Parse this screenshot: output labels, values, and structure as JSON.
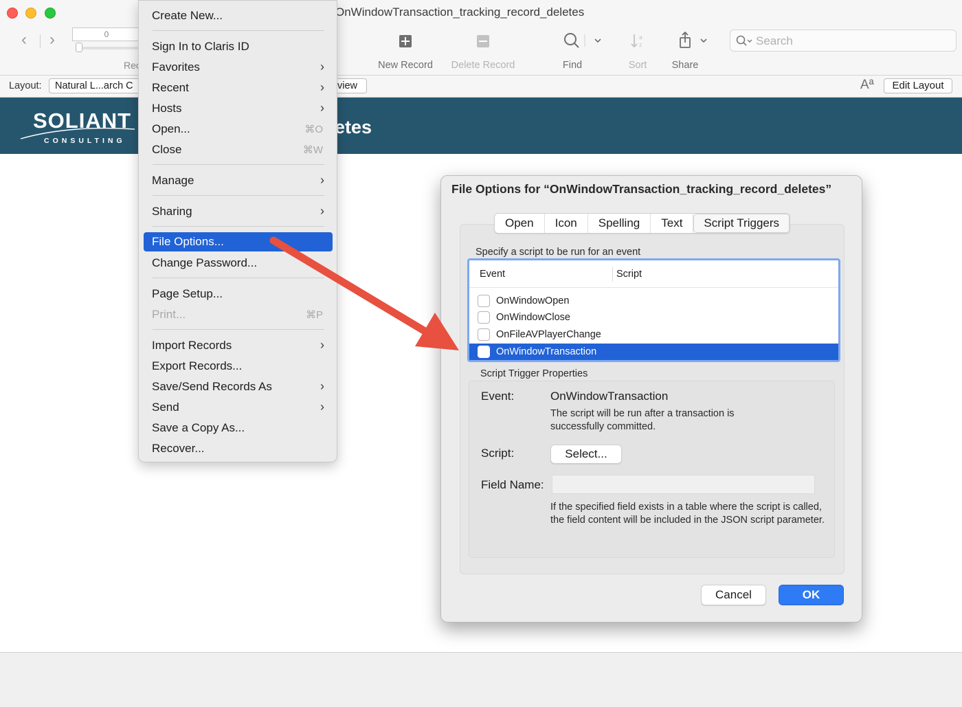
{
  "window": {
    "title": "OnWindowTransaction_tracking_record_deletes",
    "record_field_value": "0",
    "records_label_partial": "Rec"
  },
  "toolbar": {
    "new_record": "New Record",
    "delete_record": "Delete Record",
    "find": "Find",
    "sort": "Sort",
    "share": "Share",
    "search_placeholder": "Search"
  },
  "layout_bar": {
    "label": "Layout:",
    "layout_name": "Natural L...arch C",
    "view_partial": "view",
    "font_icon_text": "Aª",
    "edit_layout": "Edit Layout"
  },
  "header": {
    "logo_main": "SOLIANT",
    "logo_sub": "CONSULTING",
    "title_partial": "etes"
  },
  "menu": {
    "items": [
      {
        "label": "Create New..."
      },
      {
        "label": "Sign In to Claris ID"
      },
      {
        "label": "Favorites",
        "chevron": ">"
      },
      {
        "label": "Recent",
        "chevron": ">"
      },
      {
        "label": "Hosts",
        "chevron": ">"
      },
      {
        "label": "Open...",
        "shortcut": "⌘O"
      },
      {
        "label": "Close",
        "shortcut": "⌘W"
      },
      {
        "label": "Manage",
        "chevron": ">"
      },
      {
        "label": "Sharing",
        "chevron": ">"
      },
      {
        "label": "File Options..."
      },
      {
        "label": "Change Password..."
      },
      {
        "label": "Page Setup..."
      },
      {
        "label": "Print...",
        "shortcut": "⌘P"
      },
      {
        "label": "Import Records",
        "chevron": ">"
      },
      {
        "label": "Export Records..."
      },
      {
        "label": "Save/Send Records As",
        "chevron": ">"
      },
      {
        "label": "Send",
        "chevron": ">"
      },
      {
        "label": "Save a Copy As..."
      },
      {
        "label": "Recover..."
      }
    ]
  },
  "dialog": {
    "title": "File Options for “OnWindowTransaction_tracking_record_deletes”",
    "tabs": [
      "Open",
      "Icon",
      "Spelling",
      "Text",
      "Script Triggers"
    ],
    "active_tab": "Script Triggers",
    "spec_label": "Specify a script to be run for an event",
    "table_headers": {
      "event": "Event",
      "script": "Script"
    },
    "events": [
      "OnWindowOpen",
      "OnWindowClose",
      "OnFileAVPlayerChange",
      "OnWindowTransaction"
    ],
    "selected_event": "OnWindowTransaction",
    "properties": {
      "section_label": "Script Trigger Properties",
      "event_label": "Event:",
      "event_value": "OnWindowTransaction",
      "event_desc": "The script will be run after a transaction is successfully committed.",
      "script_label": "Script:",
      "select_button": "Select...",
      "field_name_label": "Field Name:",
      "field_name_value": "",
      "field_desc": "If the specified field exists in a table where the script is called, the field content will be included in the JSON script parameter."
    },
    "cancel": "Cancel",
    "ok": "OK"
  },
  "colors": {
    "header_band": "#26566e",
    "selection": "#2162d6",
    "ok_button": "#2f7af5",
    "arrow": "#e8503f"
  }
}
